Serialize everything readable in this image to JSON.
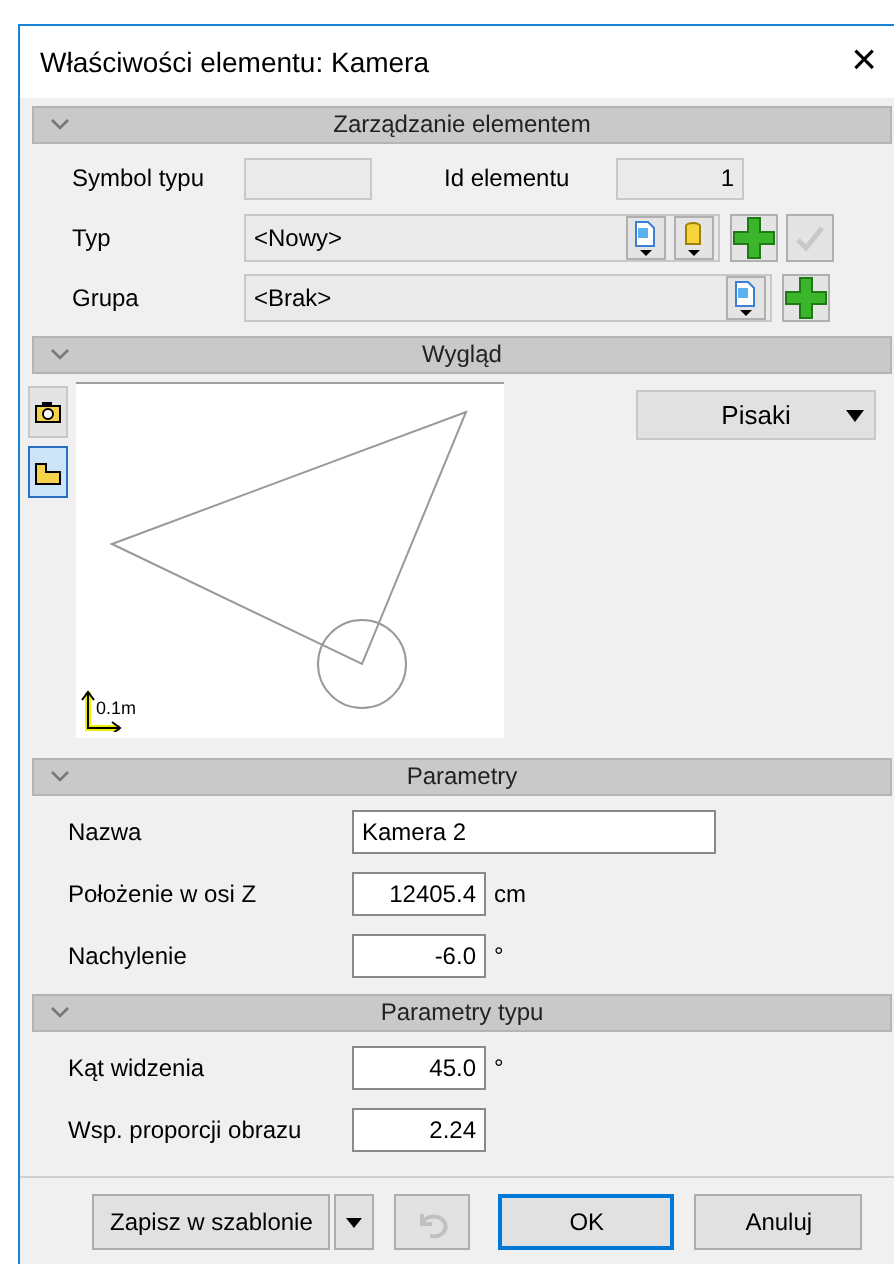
{
  "window": {
    "title": "Właściwości elementu: Kamera",
    "close": "×"
  },
  "management": {
    "header": "Zarządzanie elementem",
    "expanded": true,
    "symbol_label": "Symbol typu",
    "id_label": "Id elementu",
    "id_value": "1",
    "type_label": "Typ",
    "type_value": "<Nowy>",
    "apply_disabled": true,
    "group_label": "Grupa",
    "group_value": "<Brak>"
  },
  "appearance": {
    "header": "Wygląd",
    "expanded": true,
    "tools": [
      {
        "kind": "camera",
        "selected": false
      },
      {
        "kind": "view",
        "selected": true
      }
    ],
    "scale_label": "0.1m",
    "pens_button": "Pisaki"
  },
  "parameters": {
    "header": "Parametry",
    "expanded": true,
    "fields": [
      {
        "label": "Nazwa",
        "value": "Kamera 2",
        "kind": "text"
      },
      {
        "label": "Położenie w osi Z",
        "value": "12405.4",
        "unit": "cm",
        "kind": "number"
      },
      {
        "label": "Nachylenie",
        "value": "-6.0",
        "unit": "°",
        "kind": "number"
      }
    ]
  },
  "type_parameters": {
    "header": "Parametry typu",
    "expanded": true,
    "fields": [
      {
        "label": "Kąt widzenia",
        "value": "45.0",
        "unit": "°",
        "kind": "number"
      },
      {
        "label": "Wsp. proporcji obrazu",
        "value": "2.24",
        "kind": "number"
      }
    ]
  },
  "buttons": {
    "save_template": "Zapisz w szablonie",
    "undo_disabled": true,
    "ok": "OK",
    "ok_default": true,
    "cancel": "Anuluj"
  }
}
